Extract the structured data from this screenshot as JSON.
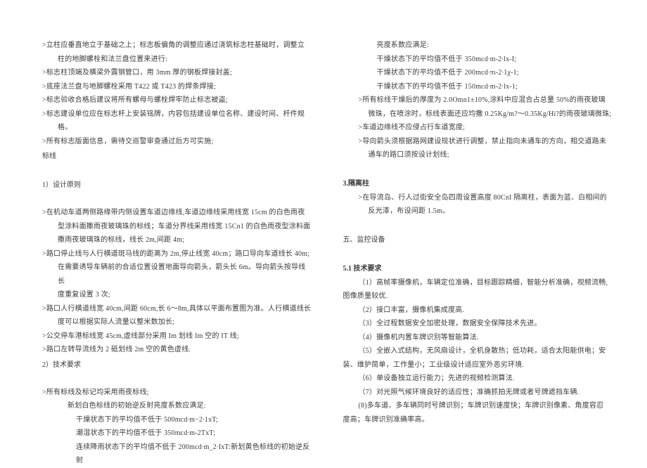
{
  "left": {
    "items": [
      {
        "cls": "line indent-1",
        "text": ">立柱应垂直地立于基础之上；标志板偏角的调整应通过浇筑标志柱基础时，调整立"
      },
      {
        "cls": "line indent-2",
        "text": "柱的地脚螺栓和法兰盘位置来进行:"
      },
      {
        "cls": "line indent-1",
        "text": ">标志柱顶端及横梁外露钢管口，用 3mm 厚的钢板焊接封盖;"
      },
      {
        "cls": "line indent-1",
        "text": ">底座法兰盘与地脚螺栓采用 T422 或 T423 的焊条焊接;"
      },
      {
        "cls": "line indent-1",
        "text": ">标志验收合格后建议将所有螺母与螺栓焊牢防止标志被盗;"
      },
      {
        "cls": "line indent-1",
        "text": ">标志建设单位应在标志杆上安装铭牌，内容包括建设单位名称、建设时间、杆件规"
      },
      {
        "cls": "line indent-2",
        "text": "格。"
      },
      {
        "cls": "line indent-1",
        "text": ">所有标志版面信息，需待交巡警审查通过后方可实施;"
      },
      {
        "cls": "section-label",
        "text": "标线"
      },
      {
        "cls": "section-label",
        "text": "1）设计原则"
      },
      {
        "cls": "line indent-1",
        "text": ""
      },
      {
        "cls": "line indent-1",
        "text": ">在机动车道两侧路缘带内侧设置车道边缘线,车道边缘线采用线宽 15cm 的白色雨夜"
      },
      {
        "cls": "line indent-2",
        "text": "型涂料面撒雨夜玻璃珠的标线；车道分界线采用线宽 15Cn1 的白色雨夜型涂料面"
      },
      {
        "cls": "line indent-2",
        "text": "撒雨夜玻璃珠的标线，线长 2m,间距 4m;"
      },
      {
        "cls": "line indent-1",
        "text": ">路口停止线与人行横道斑马线的距离为 2m,停止线宽 40cm；路口导向车道线长 40m;"
      },
      {
        "cls": "line indent-2",
        "text": "在需要诱导车辆前的合适位置设置地面导向箭头，箭头长 6m。导向箭头按导线长"
      },
      {
        "cls": "line indent-2",
        "text": "度重复设置 3 次;"
      },
      {
        "cls": "line indent-1",
        "text": ">路口人行横道线宽 40cm,间距 60cm,长 6〜8m,具体以平面布置图为准。人行横道线长"
      },
      {
        "cls": "line indent-2",
        "text": "度可以根据实际人流量以整米数加长;"
      },
      {
        "cls": "line indent-1",
        "text": ">公交停车港标线宽 45cm,虚线部分采用 Im 划线 Im 空的 IT 线;"
      },
      {
        "cls": "line indent-1",
        "text": ">路口左转导流线为 2 砥划线 2m 空的黄色虚线."
      },
      {
        "cls": "section-label",
        "text": "2）技术要求"
      },
      {
        "cls": "line indent-1",
        "text": ""
      },
      {
        "cls": "line indent-1",
        "text": ">所有标线及标记均采用雨夜标线;"
      },
      {
        "cls": "line indent-3",
        "text": "新划白色标线的初始逆反射亮度系数应满足:"
      },
      {
        "cls": "line indent-4",
        "text": "干燥状态下的平均值不低于 500mcd∙m−2∙1xT;"
      },
      {
        "cls": "line indent-4",
        "text": "潮湿状态下的平均值不低于 350mcd∙m-2TxT;"
      },
      {
        "cls": "line indent-4",
        "text": "连续降雨状态下的平均值不低于 200mcd∙m_2∙IxT:新划黄色标线的初始逆反射"
      }
    ]
  },
  "right": {
    "items": [
      {
        "cls": "line indent-4",
        "text": "亮度系数应满足:"
      },
      {
        "cls": "line indent-4",
        "text": "干燥状态下的平均值不低于 350mcd∙m-2∙lx-I;"
      },
      {
        "cls": "line indent-4",
        "text": "干燥状态下的平均值不低于 200mcd∙πι-2∙1χ-1;"
      },
      {
        "cls": "line indent-4",
        "text": "干燥状态下的平均值不低于 150mcd∙m-2∙lx-1;"
      },
      {
        "cls": "line indent-2",
        "text": ">所有标线干燥后的厚度为 2.0Omn1±10%,涂料中应混合占总量 50%的雨夜玻璃"
      },
      {
        "cls": "line indent-3",
        "text": "微珠，在喷涂时，标线表面还应均撒 0.25Kg/m?〜0.35Kg/Hi?的雨夜玻璃微珠;"
      },
      {
        "cls": "line indent-2",
        "text": ">车道边缘线不应侵占行车道宽度;"
      },
      {
        "cls": "line indent-2",
        "text": ">导向箭头须根据路网建设现状进行调整，禁止指向未通车的方向，相交道路未"
      },
      {
        "cls": "line indent-3",
        "text": "通车的路口须按设计划线;"
      },
      {
        "cls": "section-label bold",
        "text": "3.隔离柱"
      },
      {
        "cls": "line indent-2",
        "text": ">在导流岛、行人过街安全岛四周设置高度 80CnI 隔离柱，表面为蓝、白相间的"
      },
      {
        "cls": "line indent-3",
        "text": "反光漆，布设间距 1.5m。"
      },
      {
        "cls": "line indent-1",
        "text": ""
      },
      {
        "cls": "section-label",
        "text": "五、监控设备"
      },
      {
        "cls": "line indent-1",
        "text": ""
      },
      {
        "cls": "section-label bold",
        "text": "5.1 技术要求"
      },
      {
        "cls": "line indent-2",
        "text": "（1）高帧率摄像机，车辆定位准确，目标跟踪精细，智能分析准确，视频流畅,"
      },
      {
        "cls": "line indent-1",
        "text": "图像质量较优."
      },
      {
        "cls": "line indent-2",
        "text": "（2）接口丰富，摄像机集成度高."
      },
      {
        "cls": "line indent-2",
        "text": "（3）全过程数据安全加密处理，数据安全保障技术先进。"
      },
      {
        "cls": "line indent-2",
        "text": "（4）摄像机内置车牌识别等智能算法."
      },
      {
        "cls": "line indent-2",
        "text": "（5）全嵌入式结构，无风扇设计，全机身散热；低功耗，适合太阳能供电；安"
      },
      {
        "cls": "line indent-1",
        "text": "装、维护简单，工作量小；工业级设计适应室外恶劣环境."
      },
      {
        "cls": "line indent-2",
        "text": "（6）单设备独立运行能力；先进的视频检测算法."
      },
      {
        "cls": "line indent-2",
        "text": "（7）对光照气候环境良好的适应性；准确抓拍无牌或者号牌遮挡车辆."
      },
      {
        "cls": "line indent-2",
        "text": "(8)多车道、多车辆同时号牌识别；车牌识别速度快；车牌识别像素、角度容忍"
      },
      {
        "cls": "line indent-1",
        "text": "度高；车牌识别准确率高。"
      }
    ]
  }
}
